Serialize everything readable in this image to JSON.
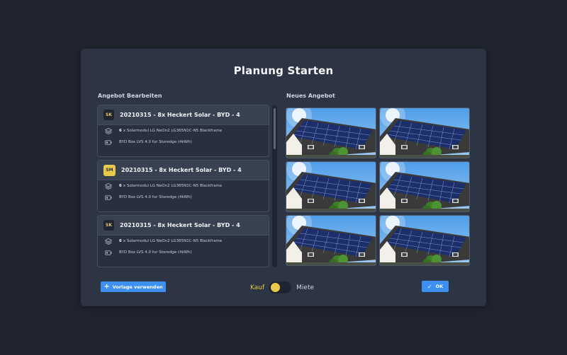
{
  "modal": {
    "title": "Planung Starten",
    "left_label": "Angebot Bearbeiten",
    "right_label": "Neues Angebot"
  },
  "offers": [
    {
      "avatar": "SK",
      "title": "20210315 - 8x Heckert Solar - BYD - 4",
      "module_qty": "6",
      "module_text": "x Solarmodul LG NeOn2 LG365N1C-N5 Blackframe",
      "battery_text": "BYD Box LVS 4.0 fur Storedge (4kWh)"
    },
    {
      "avatar": "SM",
      "title": "20210315 - 8x Heckert Solar - BYD - 4",
      "module_qty": "6",
      "module_text": "x Solarmodul LG NeOn2 LG365N1C-N5 Blackframe",
      "battery_text": "BYD Box LVS 4.0 fur Storedge (4kWh)"
    },
    {
      "avatar": "SK",
      "title": "20210315 - 8x Heckert Solar - BYD - 4",
      "module_qty": "6",
      "module_text": "x Solarmodul LG NeOn2 LG365N1C-N5 Blackframe",
      "battery_text": "BYD Box LVS 4.0 fur Storedge (4kWh)"
    }
  ],
  "footer": {
    "template_button": "Vorlage verwenden",
    "toggle_left": "Kauf",
    "toggle_right": "Miete",
    "ok_button": "OK"
  },
  "colors": {
    "accent": "#3d8ff0",
    "highlight": "#e9c94b",
    "modal_bg": "#2d3544",
    "page_bg": "#20242f"
  },
  "icons": {
    "module": "layers-icon",
    "battery": "battery-icon",
    "template": "plus-icon",
    "ok": "check-icon"
  }
}
